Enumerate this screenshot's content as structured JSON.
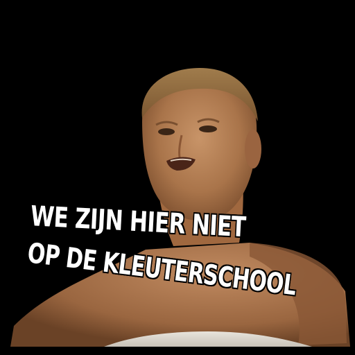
{
  "caption": {
    "line1": "WE ZIJN HIER NIET",
    "line2": "OP DE KLEUTERSCHOOL",
    "text_color": "#ffffff",
    "outline_color": "#000000"
  },
  "photo": {
    "subject": "shirtless-man",
    "background_color": "#000000",
    "skin_tone": "#b98458",
    "hair_color": "#8a6a40"
  }
}
